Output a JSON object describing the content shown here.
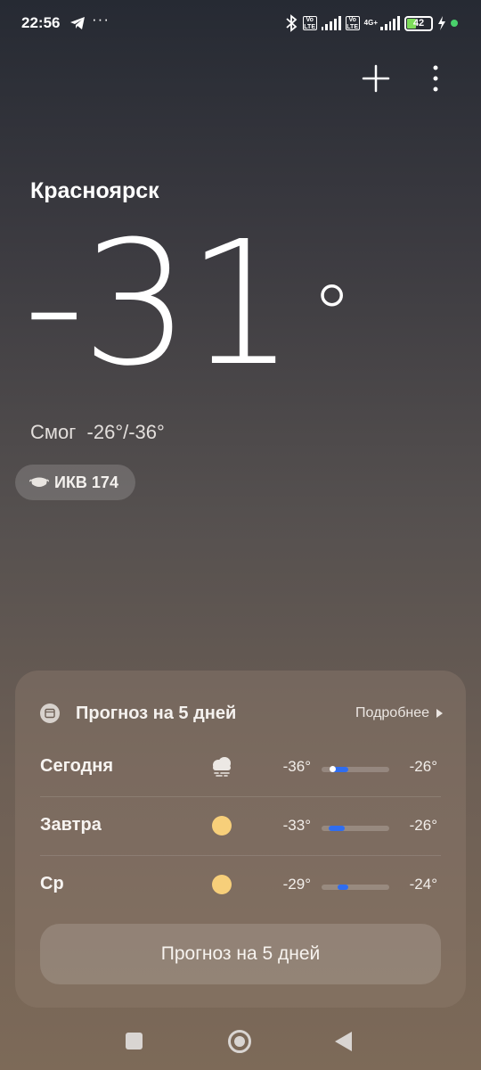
{
  "status_bar": {
    "time": "22:56",
    "dots": "···",
    "volte_label": "Vo LTE",
    "network_type": "4G+",
    "battery_percent": "42",
    "icons": [
      "telegram-icon",
      "bluetooth-icon",
      "signal-icon",
      "battery-icon",
      "charging-icon"
    ],
    "colors": {
      "battery_fill": "#7ddc5a",
      "dot": "#49d16b"
    }
  },
  "header": {
    "city": "Красноярск",
    "temperature": "-31",
    "degree": "°",
    "condition": "Смог",
    "range": "-26°/-36°",
    "aqi": "ИКВ 174"
  },
  "forecast": {
    "title": "Прогноз на 5 дней",
    "more_label": "Подробнее",
    "days": [
      {
        "day": "Сегодня",
        "icon": "snow-cloud-icon",
        "low": "-36°",
        "high": "-26°"
      },
      {
        "day": "Завтра",
        "icon": "sun-icon",
        "low": "-33°",
        "high": "-26°"
      },
      {
        "day": "Ср",
        "icon": "sun-icon",
        "low": "-29°",
        "high": "-24°"
      }
    ],
    "button_label": "Прогноз на 5 дней",
    "colors": {
      "bar_fill": "#2f6df0",
      "sun": "#f7cf7a"
    }
  }
}
